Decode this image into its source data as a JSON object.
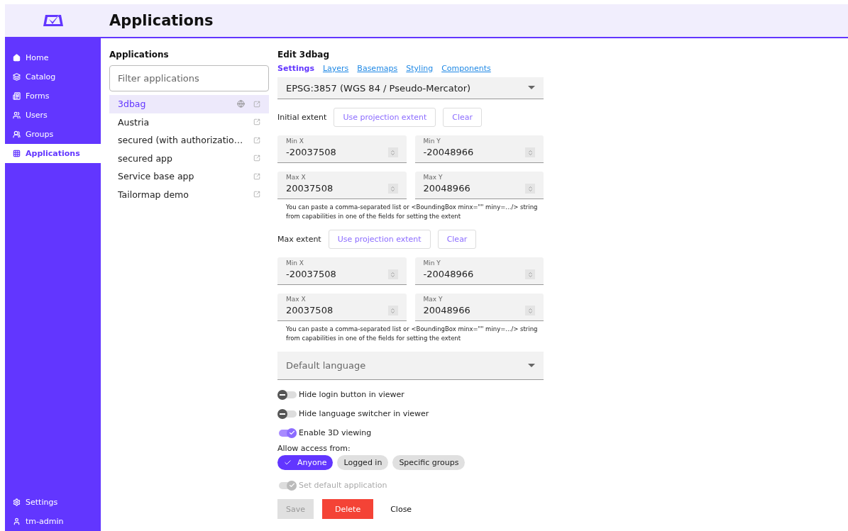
{
  "header": {
    "title": "Applications"
  },
  "nav": {
    "items": [
      {
        "label": "Home",
        "selected": false
      },
      {
        "label": "Catalog",
        "selected": false
      },
      {
        "label": "Forms",
        "selected": false
      },
      {
        "label": "Users",
        "selected": false
      },
      {
        "label": "Groups",
        "selected": false
      },
      {
        "label": "Applications",
        "selected": true
      }
    ],
    "bottom": [
      {
        "label": "Settings"
      },
      {
        "label": "tm-admin"
      }
    ]
  },
  "app_list": {
    "title": "Applications",
    "filter": {
      "placeholder": "Filter applications"
    },
    "items": [
      {
        "name": "3dbag",
        "selected": true,
        "default": true
      },
      {
        "name": "Austria",
        "selected": false,
        "default": false
      },
      {
        "name": "secured (with authorizatio…",
        "selected": false,
        "default": false
      },
      {
        "name": "secured app",
        "selected": false,
        "default": false
      },
      {
        "name": "Service base app",
        "selected": false,
        "default": false
      },
      {
        "name": "Tailormap demo",
        "selected": false,
        "default": false
      }
    ]
  },
  "editor": {
    "title": "Edit 3dbag",
    "tabs": [
      {
        "label": "Settings",
        "selected": true
      },
      {
        "label": "Layers",
        "selected": false
      },
      {
        "label": "Basemaps",
        "selected": false
      },
      {
        "label": "Styling",
        "selected": false
      },
      {
        "label": "Components",
        "selected": false
      }
    ],
    "projection": {
      "value": "EPSG:3857 (WGS 84 / Pseudo-Mercator)"
    },
    "extents": [
      {
        "label": "Initial extent",
        "buttons": [
          "Use projection extent",
          "Clear"
        ],
        "fields": [
          {
            "label": "Min X",
            "value": "-20037508"
          },
          {
            "label": "Min Y",
            "value": "-20048966"
          },
          {
            "label": "Max X",
            "value": "20037508"
          },
          {
            "label": "Max Y",
            "value": "20048966"
          }
        ],
        "hint": "You can paste a comma-separated list or <BoundingBox minx=\"\" miny=.../> string from capabilities in one of the fields for setting the extent"
      },
      {
        "label": "Max extent",
        "buttons": [
          "Use projection extent",
          "Clear"
        ],
        "fields": [
          {
            "label": "Min X",
            "value": "-20037508"
          },
          {
            "label": "Min Y",
            "value": "-20048966"
          },
          {
            "label": "Max X",
            "value": "20037508"
          },
          {
            "label": "Max Y",
            "value": "20048966"
          }
        ],
        "hint": "You can paste a comma-separated list or <BoundingBox minx=\"\" miny=.../> string from capabilities in one of the fields for setting the extent"
      }
    ],
    "language": {
      "placeholder": "Default language"
    },
    "toggles": [
      {
        "label": "Hide login button in viewer",
        "on": false,
        "disabled": false
      },
      {
        "label": "Hide language switcher in viewer",
        "on": false,
        "disabled": false
      },
      {
        "label": "Enable 3D viewing",
        "on": true,
        "disabled": false
      }
    ],
    "access": {
      "label": "Allow access from:",
      "options": [
        {
          "label": "Anyone",
          "selected": true
        },
        {
          "label": "Logged in",
          "selected": false
        },
        {
          "label": "Specific groups",
          "selected": false
        }
      ]
    },
    "default_toggle": {
      "label": "Set default application",
      "on": true,
      "disabled": true
    },
    "actions": [
      {
        "label": "Save",
        "kind": "save",
        "disabled": true
      },
      {
        "label": "Delete",
        "kind": "danger"
      },
      {
        "label": "Close",
        "kind": "text"
      }
    ]
  }
}
